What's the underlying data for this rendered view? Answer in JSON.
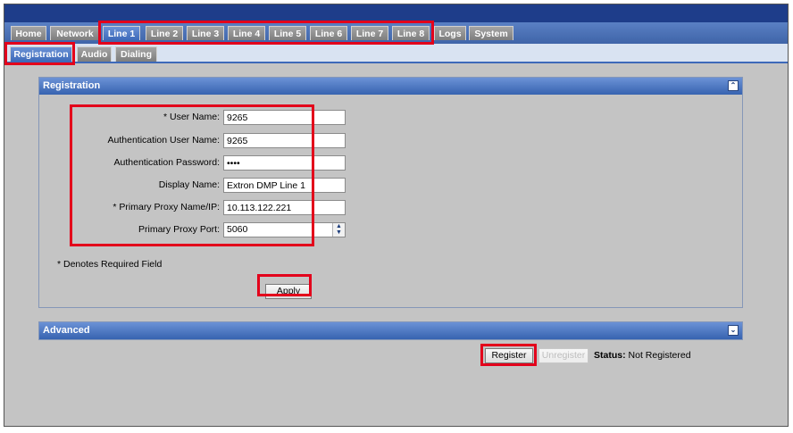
{
  "nav": {
    "tabs": [
      {
        "label": "Home"
      },
      {
        "label": "Network"
      },
      {
        "label": "Line 1"
      },
      {
        "label": "Line 2"
      },
      {
        "label": "Line 3"
      },
      {
        "label": "Line 4"
      },
      {
        "label": "Line 5"
      },
      {
        "label": "Line 6"
      },
      {
        "label": "Line 7"
      },
      {
        "label": "Line 8"
      },
      {
        "label": "Logs"
      },
      {
        "label": "System"
      }
    ],
    "active_tab": "Line 1",
    "subtabs": [
      {
        "label": "Registration"
      },
      {
        "label": "Audio"
      },
      {
        "label": "Dialing"
      }
    ],
    "active_subtab": "Registration"
  },
  "registration": {
    "title": "Registration",
    "collapse_icon": "double-chevron-up-icon",
    "fields": [
      {
        "label": "* User Name:",
        "value": "9265",
        "type": "text"
      },
      {
        "label": "Authentication User Name:",
        "value": "9265",
        "type": "text"
      },
      {
        "label": "Authentication Password:",
        "value": "••••",
        "type": "password"
      },
      {
        "label": "Display Name:",
        "value": "Extron DMP Line 1",
        "type": "text"
      },
      {
        "label": "* Primary Proxy Name/IP:",
        "value": "10.113.122.221",
        "type": "text"
      },
      {
        "label": "Primary Proxy Port:",
        "value": "5060",
        "type": "number"
      }
    ],
    "required_note": "* Denotes Required Field",
    "apply_label": "Apply"
  },
  "advanced": {
    "title": "Advanced",
    "expand_icon": "double-chevron-down-icon"
  },
  "actions": {
    "register_label": "Register",
    "unregister_label": "Unregister",
    "status_label": "Status:",
    "status_value": "Not Registered"
  },
  "colors": {
    "highlight": "#e3001b",
    "active_tab": "#3d69b9",
    "top_bar": "#1e3d8a",
    "panel_header": "#3763b0"
  }
}
